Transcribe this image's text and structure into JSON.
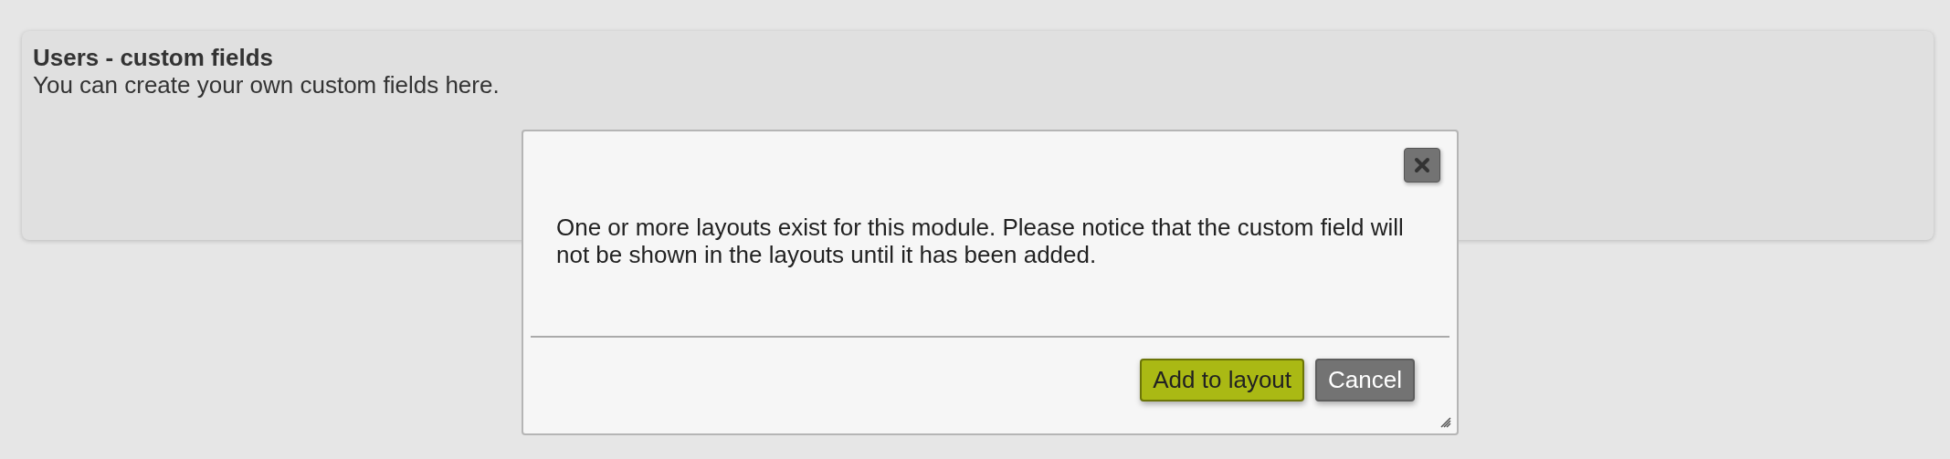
{
  "panel": {
    "title": "Users - custom fields",
    "description": "You can create your own custom fields here."
  },
  "dialog": {
    "message": "One or more layouts exist for this module. Please notice that the custom field will not be shown in the layouts until it has been added.",
    "buttons": [
      {
        "label": "Add to layout",
        "kind": "primary"
      },
      {
        "label": "Cancel",
        "kind": "secondary"
      }
    ]
  }
}
